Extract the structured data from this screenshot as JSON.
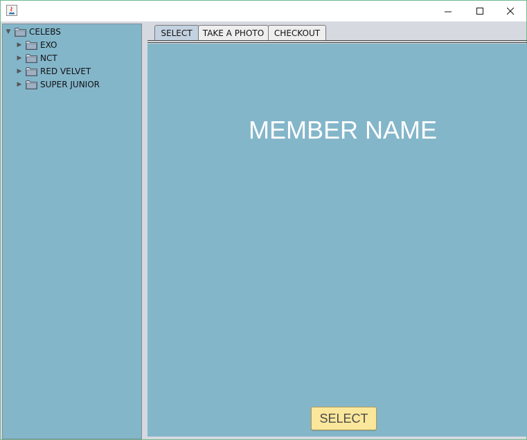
{
  "window": {
    "controls": {
      "minimize": "—",
      "maximize": "☐",
      "close": "✕"
    }
  },
  "tree": {
    "root": {
      "label": "CELEBS",
      "expanded": true
    },
    "children": [
      {
        "label": "EXO",
        "expanded": false
      },
      {
        "label": "NCT",
        "expanded": false
      },
      {
        "label": "RED VELVET",
        "expanded": false
      },
      {
        "label": "SUPER JUNIOR",
        "expanded": false
      }
    ]
  },
  "tabs": [
    {
      "label": "SELECT",
      "selected": true
    },
    {
      "label": "TAKE A PHOTO",
      "selected": false
    },
    {
      "label": "CHECKOUT",
      "selected": false
    }
  ],
  "content": {
    "member_name": "MEMBER NAME",
    "select_button": "SELECT"
  },
  "colors": {
    "panel_bg": "#84b6ca",
    "button_bg": "#fbe79b",
    "title_text": "#ffffff"
  }
}
